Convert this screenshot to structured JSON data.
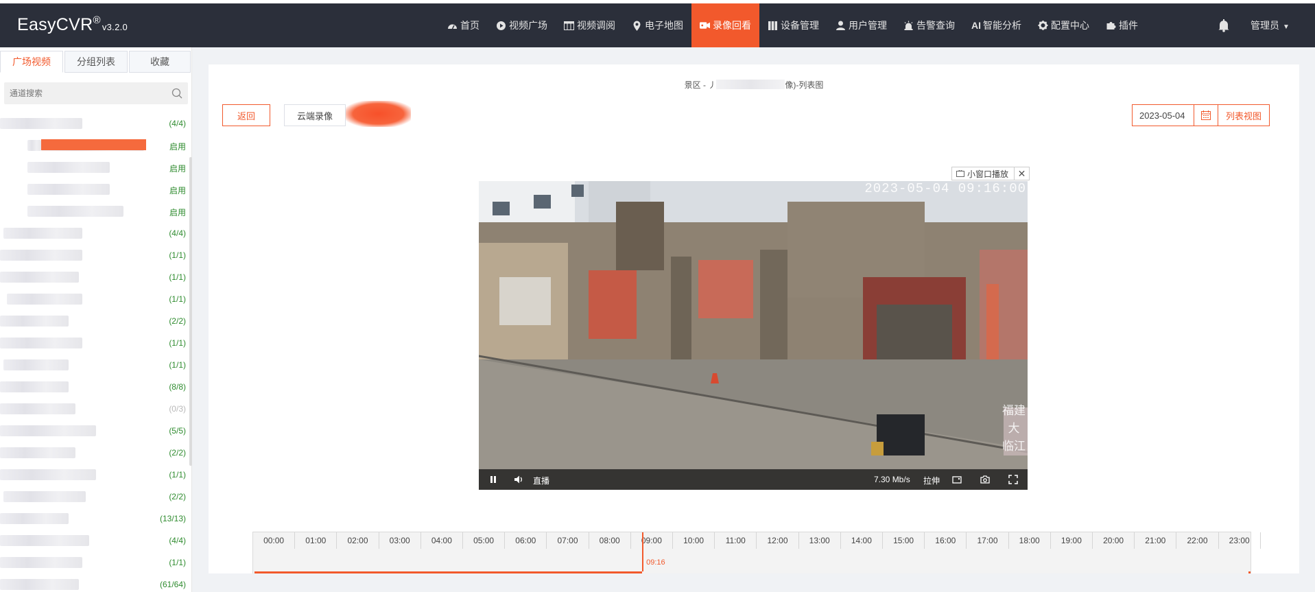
{
  "app": {
    "brand": "EasyCVR",
    "brand_mark": "®",
    "version": "v3.2.0"
  },
  "nav": {
    "items": [
      {
        "label": "首页",
        "icon": "dashboard-icon"
      },
      {
        "label": "视频广场",
        "icon": "play-circle-icon"
      },
      {
        "label": "视频调阅",
        "icon": "grid-layout-icon"
      },
      {
        "label": "电子地图",
        "icon": "map-pin-icon"
      },
      {
        "label": "录像回看",
        "icon": "video-camera-icon",
        "active": true
      },
      {
        "label": "设备管理",
        "icon": "device-icon"
      },
      {
        "label": "用户管理",
        "icon": "user-icon"
      },
      {
        "label": "告警查询",
        "icon": "alarm-icon"
      },
      {
        "label": "智能分析",
        "icon": "ai-icon",
        "prefix": "AI"
      },
      {
        "label": "配置中心",
        "icon": "gear-icon"
      },
      {
        "label": "插件",
        "icon": "puzzle-icon"
      }
    ],
    "user": "管理员"
  },
  "sidebar": {
    "tabs": [
      {
        "label": "广场视频",
        "active": true
      },
      {
        "label": "分组列表"
      },
      {
        "label": "收藏"
      }
    ],
    "search_placeholder": "通道搜索",
    "rows": [
      {
        "count": "(4/4)"
      },
      {
        "count": "启用",
        "highlight": true
      },
      {
        "count": "启用"
      },
      {
        "count": "启用"
      },
      {
        "count": "启用"
      },
      {
        "count": "(4/4)"
      },
      {
        "count": "(1/1)"
      },
      {
        "count": "(1/1)"
      },
      {
        "count": "(1/1)"
      },
      {
        "count": "(2/2)"
      },
      {
        "count": "(1/1)"
      },
      {
        "count": "(1/1)"
      },
      {
        "count": "(8/8)"
      },
      {
        "count": "(0/3)",
        "offline": true
      },
      {
        "count": "(5/5)"
      },
      {
        "count": "(2/2)"
      },
      {
        "count": "(1/1)"
      },
      {
        "count": "(2/2)"
      },
      {
        "count": "(13/13)"
      },
      {
        "count": "(4/4)"
      },
      {
        "count": "(1/1)"
      },
      {
        "count": "(61/64)"
      }
    ]
  },
  "main": {
    "title_prefix": "景区 - 丿",
    "title_suffix": "像)-列表图",
    "back_label": "返回",
    "cloud_label": "云端录像",
    "date": "2023-05-04",
    "list_view_label": "列表视图",
    "mini_window_label": "小窗口播放"
  },
  "player": {
    "timestamp": "2023-05-04 09:16:00",
    "live_label": "直播",
    "bitrate": "7.30 Mb/s",
    "stretch_label": "拉伸",
    "overlay_text": [
      "福建",
      "大",
      "临江"
    ]
  },
  "timeline": {
    "hours": [
      "00:00",
      "01:00",
      "02:00",
      "03:00",
      "04:00",
      "05:00",
      "06:00",
      "07:00",
      "08:00",
      "09:00",
      "10:00",
      "11:00",
      "12:00",
      "13:00",
      "14:00",
      "15:00",
      "16:00",
      "17:00",
      "18:00",
      "19:00",
      "20:00",
      "21:00",
      "22:00",
      "23:00"
    ],
    "current": "09:16",
    "current_fraction": 0.3861
  },
  "colors": {
    "accent": "#f2592c",
    "header_bg": "#2b2f3a",
    "online": "#2e8b2e",
    "offline": "#b8b8b8"
  }
}
